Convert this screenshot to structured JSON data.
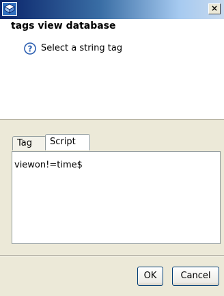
{
  "window": {
    "close_label": "×"
  },
  "header": {
    "title": "tags view database",
    "message": "Select a string tag"
  },
  "tabs": [
    {
      "label": "Tag",
      "selected": false
    },
    {
      "label": "Script",
      "selected": true
    }
  ],
  "editor": {
    "text": "viewon!=time$"
  },
  "buttons": {
    "ok": "OK",
    "cancel": "Cancel"
  },
  "colors": {
    "titlebar_dark": "#0a246a",
    "titlebar_light": "#a6caf0",
    "dialog_bg": "#ece9d8",
    "header_bg": "#ffffff",
    "button_border": "#003c74"
  }
}
